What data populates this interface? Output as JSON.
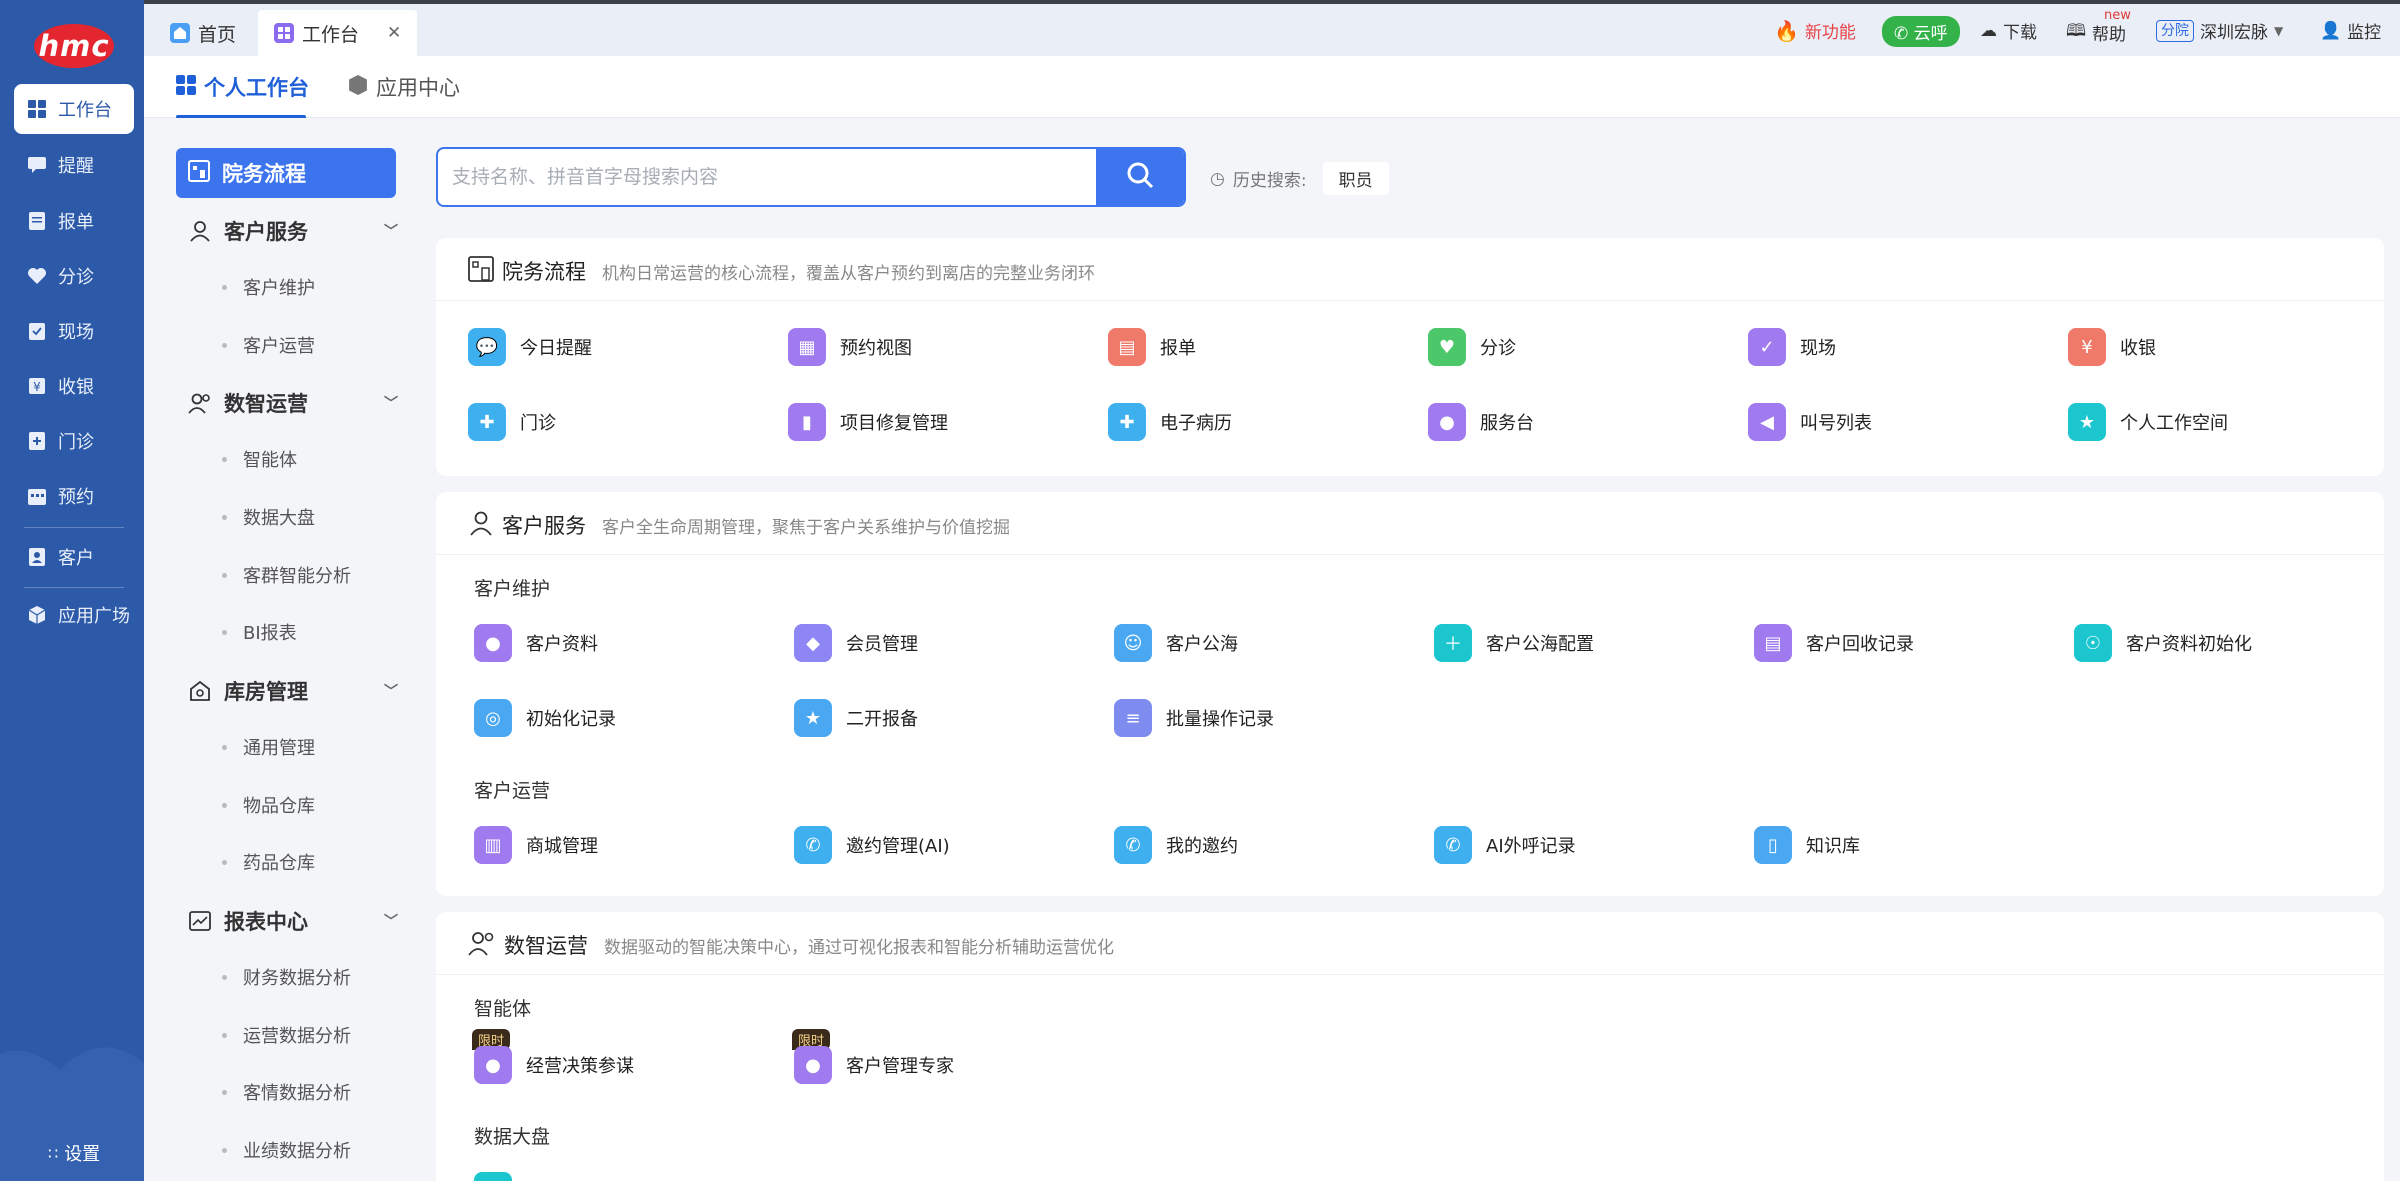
{
  "brand": {
    "logo_text": "hmc"
  },
  "left_nav": {
    "items": [
      {
        "label": "工作台",
        "icon": "dashboard-icon"
      },
      {
        "label": "提醒",
        "icon": "message-icon"
      },
      {
        "label": "报单",
        "icon": "document-icon"
      },
      {
        "label": "分诊",
        "icon": "heart-icon"
      },
      {
        "label": "现场",
        "icon": "clipboard-icon"
      },
      {
        "label": "收银",
        "icon": "yen-icon"
      },
      {
        "label": "门诊",
        "icon": "medical-icon"
      },
      {
        "label": "预约",
        "icon": "calendar-icon"
      },
      {
        "label": "客户",
        "icon": "contact-icon"
      },
      {
        "label": "应用广场",
        "icon": "cube-icon"
      }
    ],
    "settings_label": "设置"
  },
  "tabs": [
    {
      "label": "首页"
    },
    {
      "label": "工作台"
    }
  ],
  "top_right": {
    "new_feature": "新功能",
    "cloud_call": "云呼",
    "download": "下载",
    "help": "帮助",
    "help_badge": "new",
    "branch_tag": "分院",
    "branch_name": "深圳宏脉",
    "monitor": "监控"
  },
  "sub_tabs": [
    {
      "label": "个人工作台"
    },
    {
      "label": "应用中心"
    }
  ],
  "side_nav": {
    "active": "院务流程",
    "groups": [
      {
        "label": "客户服务",
        "items": [
          "客户维护",
          "客户运营"
        ]
      },
      {
        "label": "数智运营",
        "items": [
          "智能体",
          "数据大盘",
          "客群智能分析",
          "BI报表"
        ]
      },
      {
        "label": "库房管理",
        "items": [
          "通用管理",
          "物品仓库",
          "药品仓库"
        ]
      },
      {
        "label": "报表中心",
        "items": [
          "财务数据分析",
          "运营数据分析",
          "客情数据分析",
          "业绩数据分析"
        ]
      }
    ]
  },
  "search": {
    "placeholder": "支持名称、拼音首字母搜索内容",
    "history_label": "历史搜索:",
    "history_chip": "职员"
  },
  "sections": {
    "workflow": {
      "title": "院务流程",
      "desc": "机构日常运营的核心流程，覆盖从客户预约到离店的完整业务闭环",
      "apps": [
        "今日提醒",
        "预约视图",
        "报单",
        "分诊",
        "现场",
        "收银",
        "门诊",
        "项目修复管理",
        "电子病历",
        "服务台",
        "叫号列表",
        "个人工作空间"
      ]
    },
    "customer": {
      "title": "客户服务",
      "desc": "客户全生命周期管理，聚焦于客户关系维护与价值挖掘",
      "sub1": "客户维护",
      "apps1": [
        "客户资料",
        "会员管理",
        "客户公海",
        "客户公海配置",
        "客户回收记录",
        "客户资料初始化",
        "初始化记录",
        "二开报备",
        "批量操作记录"
      ],
      "sub2": "客户运营",
      "apps2": [
        "商城管理",
        "邀约管理(AI)",
        "我的邀约",
        "AI外呼记录",
        "知识库"
      ]
    },
    "data_ops": {
      "title": "数智运营",
      "desc": "数据驱动的智能决策中心，通过可视化报表和智能分析辅助运营优化",
      "sub1": "智能体",
      "limit_tag": "限时",
      "apps1": [
        "经营决策参谋",
        "客户管理专家"
      ],
      "sub2": "数据大盘"
    }
  },
  "colors": {
    "brand_blue": "#2c5aa8",
    "accent": "#3c74ee",
    "logo_red": "#e3262f",
    "green": "#33b24a"
  }
}
